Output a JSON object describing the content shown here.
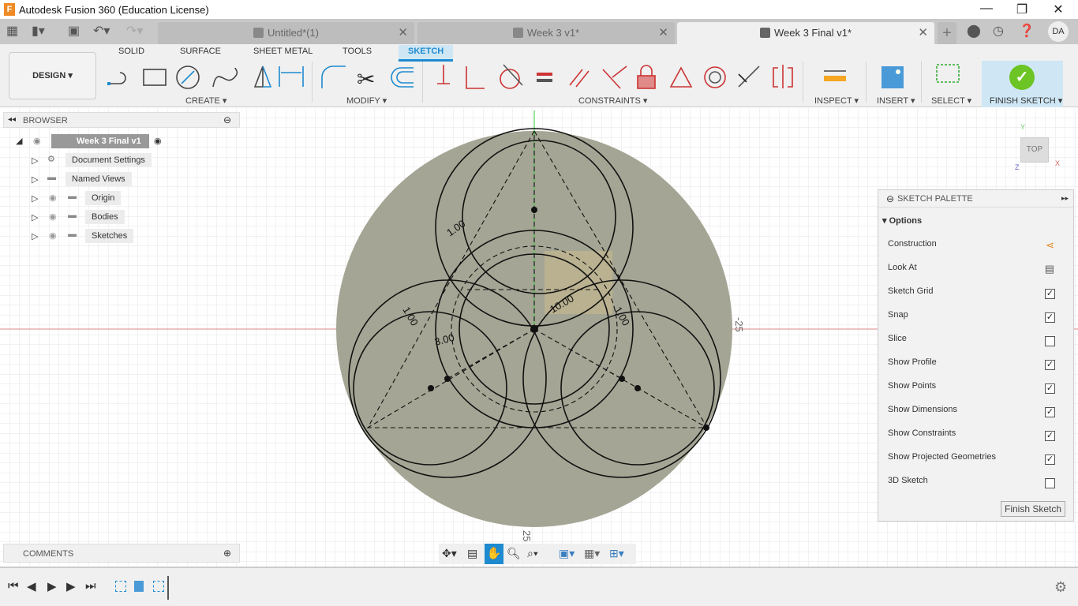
{
  "window": {
    "title": "Autodesk Fusion 360 (Education License)",
    "logo": "F"
  },
  "tabs": [
    {
      "label": "Untitled*(1)",
      "active": false
    },
    {
      "label": "Week 3 v1*",
      "active": false
    },
    {
      "label": "Week 3 Final v1*",
      "active": true
    }
  ],
  "user": {
    "initials": "DA"
  },
  "ribbon": {
    "workspace": "DESIGN ▾",
    "tabs": [
      "SOLID",
      "SURFACE",
      "SHEET METAL",
      "TOOLS",
      "SKETCH"
    ],
    "active_tab": "SKETCH",
    "groups": {
      "create": "CREATE ▾",
      "modify": "MODIFY ▾",
      "constraints": "CONSTRAINTS ▾",
      "inspect": "INSPECT ▾",
      "insert": "INSERT ▾",
      "select": "SELECT ▾",
      "finish": "FINISH SKETCH ▾"
    }
  },
  "browser": {
    "title": "BROWSER",
    "root": "Week 3 Final v1",
    "items": [
      "Document Settings",
      "Named Views",
      "Origin",
      "Bodies",
      "Sketches"
    ]
  },
  "comments": {
    "title": "COMMENTS"
  },
  "viewcube": {
    "face": "TOP",
    "axis_y": "Y",
    "axis_x": "X",
    "axis_z": "Z"
  },
  "sketch": {
    "dimensions": [
      "1.00",
      "10.00",
      "1.00",
      "3.00",
      "1.00"
    ],
    "axis_labels": [
      "-25",
      "25"
    ]
  },
  "palette": {
    "title": "SKETCH PALETTE",
    "section": "Options",
    "options": [
      {
        "label": "Construction",
        "type": "icon"
      },
      {
        "label": "Look At",
        "type": "icon"
      },
      {
        "label": "Sketch Grid",
        "checked": true
      },
      {
        "label": "Snap",
        "checked": true
      },
      {
        "label": "Slice",
        "checked": false
      },
      {
        "label": "Show Profile",
        "checked": true
      },
      {
        "label": "Show Points",
        "checked": true
      },
      {
        "label": "Show Dimensions",
        "checked": true
      },
      {
        "label": "Show Constraints",
        "checked": true
      },
      {
        "label": "Show Projected Geometries",
        "checked": true
      },
      {
        "label": "3D Sketch",
        "checked": false
      }
    ],
    "finish_button": "Finish Sketch"
  },
  "colors": {
    "accent": "#1e8ad0",
    "finish_green": "#6cc425",
    "profile": "#a4a594"
  }
}
